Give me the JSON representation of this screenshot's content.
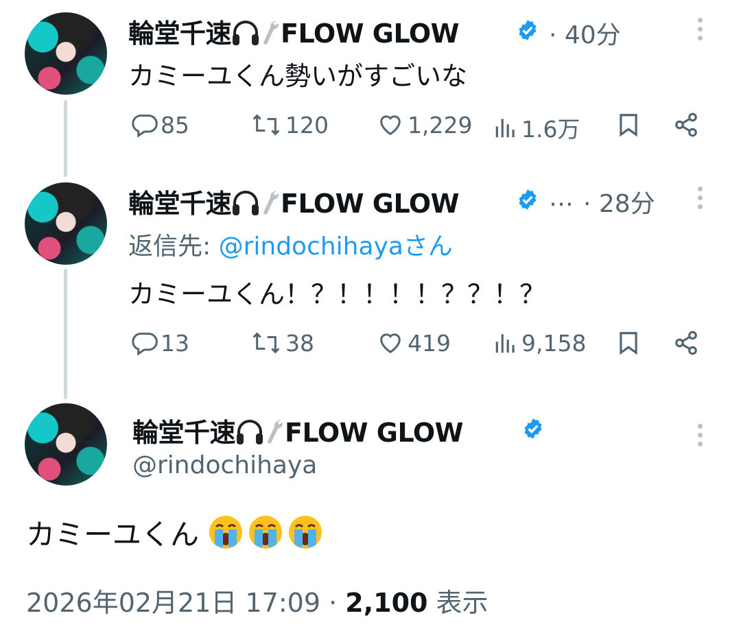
{
  "tweets": [
    {
      "display_name": "輪堂千速",
      "name_suffix": "FLOW GLOW",
      "time": "· 40分",
      "text": "カミーユくん勢いがすごいな",
      "stats": {
        "replies": "85",
        "retweets": "120",
        "likes": "1,229",
        "views": "1.6万"
      }
    },
    {
      "display_name": "輪堂千速",
      "name_suffix": "FLOW GLOW",
      "ellipsis": "…",
      "time": "· 28分",
      "reply_prefix": "返信先: ",
      "reply_handle": "@rindochihayaさん",
      "text": "カミーユくん！？！！！！？？！？",
      "stats": {
        "replies": "13",
        "retweets": "38",
        "likes": "419",
        "views": "9,158"
      }
    }
  ],
  "main_tweet": {
    "display_name": "輪堂千速",
    "name_suffix": "FLOW GLOW",
    "handle": "@rindochihaya",
    "text": "カミーユくん",
    "emoji": [
      "loudly-crying-face",
      "loudly-crying-face",
      "loudly-crying-face"
    ],
    "timestamp": "2026年02月21日 17:09",
    "separator": " · ",
    "view_count": "2,100",
    "view_label": " 表示"
  },
  "colors": {
    "verified": "#1d9bf0",
    "muted": "#536471",
    "link": "#1d9bf0"
  },
  "icons": [
    "headphone-icon",
    "wrench-icon",
    "verified-badge-icon",
    "reply-icon",
    "retweet-icon",
    "like-icon",
    "views-icon",
    "bookmark-icon",
    "share-icon",
    "more-icon"
  ]
}
